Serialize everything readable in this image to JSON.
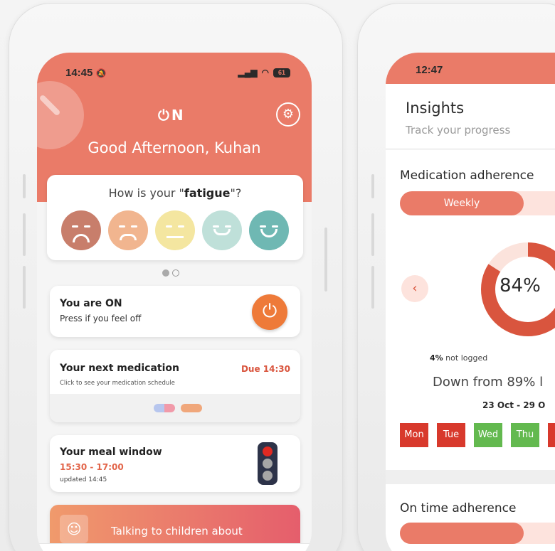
{
  "phone1": {
    "status": {
      "time": "14:45",
      "mute_icon": "bell-slash-icon",
      "battery": "61"
    },
    "app_logo": "ON",
    "greeting": "Good Afternoon, Kuhan",
    "fatigue": {
      "prefix": "How is your \"",
      "keyword": "fatigue",
      "suffix": "\"?",
      "faces": [
        "very-sad",
        "sad",
        "neutral",
        "happy",
        "very-happy"
      ],
      "face_colors": [
        "#c87e6b",
        "#f1b58f",
        "#f4e6a0",
        "#bfe0d9",
        "#6fb8b3"
      ]
    },
    "carousel": {
      "active_index": 0,
      "count": 2
    },
    "on_card": {
      "title": "You are ON",
      "subtitle": "Press if you feel off"
    },
    "medication_card": {
      "title": "Your next medication",
      "due": "Due 14:30",
      "hint": "Click to see your medication schedule"
    },
    "meal_card": {
      "title": "Your meal window",
      "window": "15:30 - 17:00",
      "updated": "updated 14:45",
      "traffic_light": "red"
    },
    "promo": {
      "text": "Talking to children about"
    }
  },
  "phone2": {
    "status": {
      "time": "12:47"
    },
    "header": {
      "title": "Insights",
      "subtitle": "Track your progress"
    },
    "medication_adherence": {
      "title": "Medication adherence",
      "period": "Weekly",
      "percent_label": "84%",
      "percent": 84,
      "not_logged_value": "4%",
      "not_logged_label": " not logged",
      "comparison": "Down from 89% l",
      "date_range": "23 Oct - 29 O",
      "days": [
        {
          "label": "Mon",
          "status": "missed"
        },
        {
          "label": "Tue",
          "status": "missed"
        },
        {
          "label": "Wed",
          "status": "taken"
        },
        {
          "label": "Thu",
          "status": "taken"
        }
      ]
    },
    "on_time_adherence": {
      "title": "On time adherence"
    }
  },
  "colors": {
    "brand": "#ea7b68",
    "missed": "#d8392c",
    "taken": "#63b94f",
    "power": "#ee7a39"
  }
}
